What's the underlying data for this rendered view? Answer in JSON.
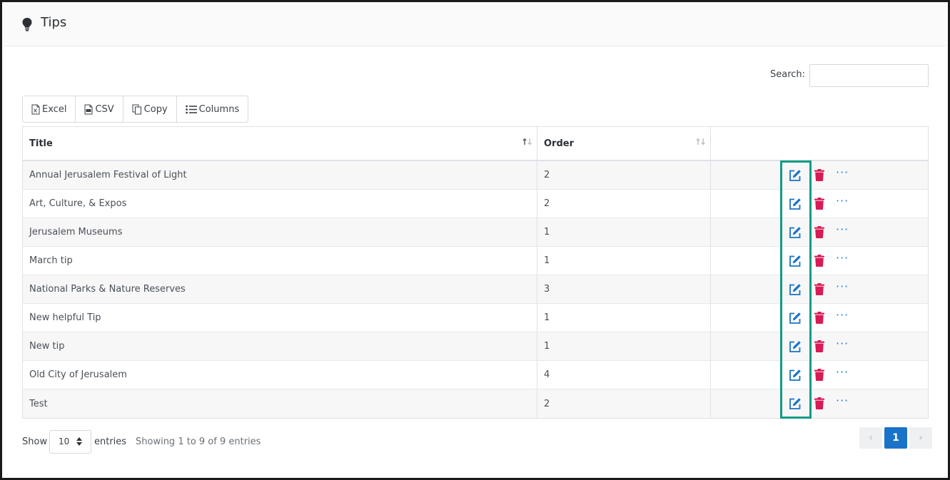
{
  "header": {
    "title": "Tips",
    "icon": "lightbulb-icon"
  },
  "search": {
    "label": "Search:",
    "value": "",
    "placeholder": ""
  },
  "toolbar": {
    "buttons": [
      {
        "label": "Excel",
        "icon": "excel-file-icon"
      },
      {
        "label": "CSV",
        "icon": "csv-file-icon"
      },
      {
        "label": "Copy",
        "icon": "copy-icon"
      },
      {
        "label": "Columns",
        "icon": "list-icon"
      }
    ]
  },
  "table": {
    "columns": [
      {
        "label": "Title",
        "sort": "asc"
      },
      {
        "label": "Order",
        "sort": "none"
      },
      {
        "label": ""
      }
    ],
    "rows": [
      {
        "title": "Annual Jerusalem Festival of Light",
        "order": "2"
      },
      {
        "title": "Art, Culture, & Expos",
        "order": "2"
      },
      {
        "title": "Jerusalem Museums",
        "order": "1"
      },
      {
        "title": "March tip",
        "order": "1"
      },
      {
        "title": "National Parks & Nature Reserves",
        "order": "3"
      },
      {
        "title": "New helpful Tip",
        "order": "1"
      },
      {
        "title": "New tip",
        "order": "1"
      },
      {
        "title": "Old City of Jerusalem",
        "order": "4"
      },
      {
        "title": "Test",
        "order": "2"
      }
    ],
    "row_actions": {
      "edit_icon": "edit-icon",
      "delete_icon": "trash-icon",
      "more_label": "···"
    }
  },
  "footer": {
    "show_label": "Show",
    "page_length": "10",
    "entries_label": "entries",
    "info": "Showing 1 to 9 of 9 entries",
    "pagination": {
      "prev": "‹",
      "current": "1",
      "next": "›"
    }
  },
  "colors": {
    "accent": "#1a73c8",
    "delete": "#d81b54",
    "highlight": "#129c86"
  }
}
